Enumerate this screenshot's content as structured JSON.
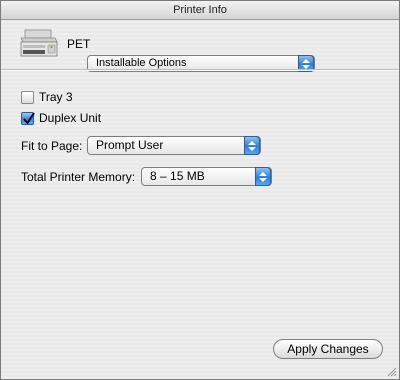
{
  "window": {
    "title": "Printer Info"
  },
  "printer": {
    "name": "PET",
    "icon": "printer-icon"
  },
  "section_popup": {
    "selected": "Installable Options"
  },
  "options": {
    "tray3": {
      "label": "Tray 3",
      "checked": false
    },
    "duplex": {
      "label": "Duplex Unit",
      "checked": true
    }
  },
  "fit_to_page": {
    "label": "Fit to Page:",
    "selected": "Prompt User"
  },
  "memory": {
    "label": "Total Printer Memory:",
    "selected": "8 – 15 MB"
  },
  "apply_button": {
    "label": "Apply Changes"
  },
  "colors": {
    "accent": "#3a8ae0"
  }
}
